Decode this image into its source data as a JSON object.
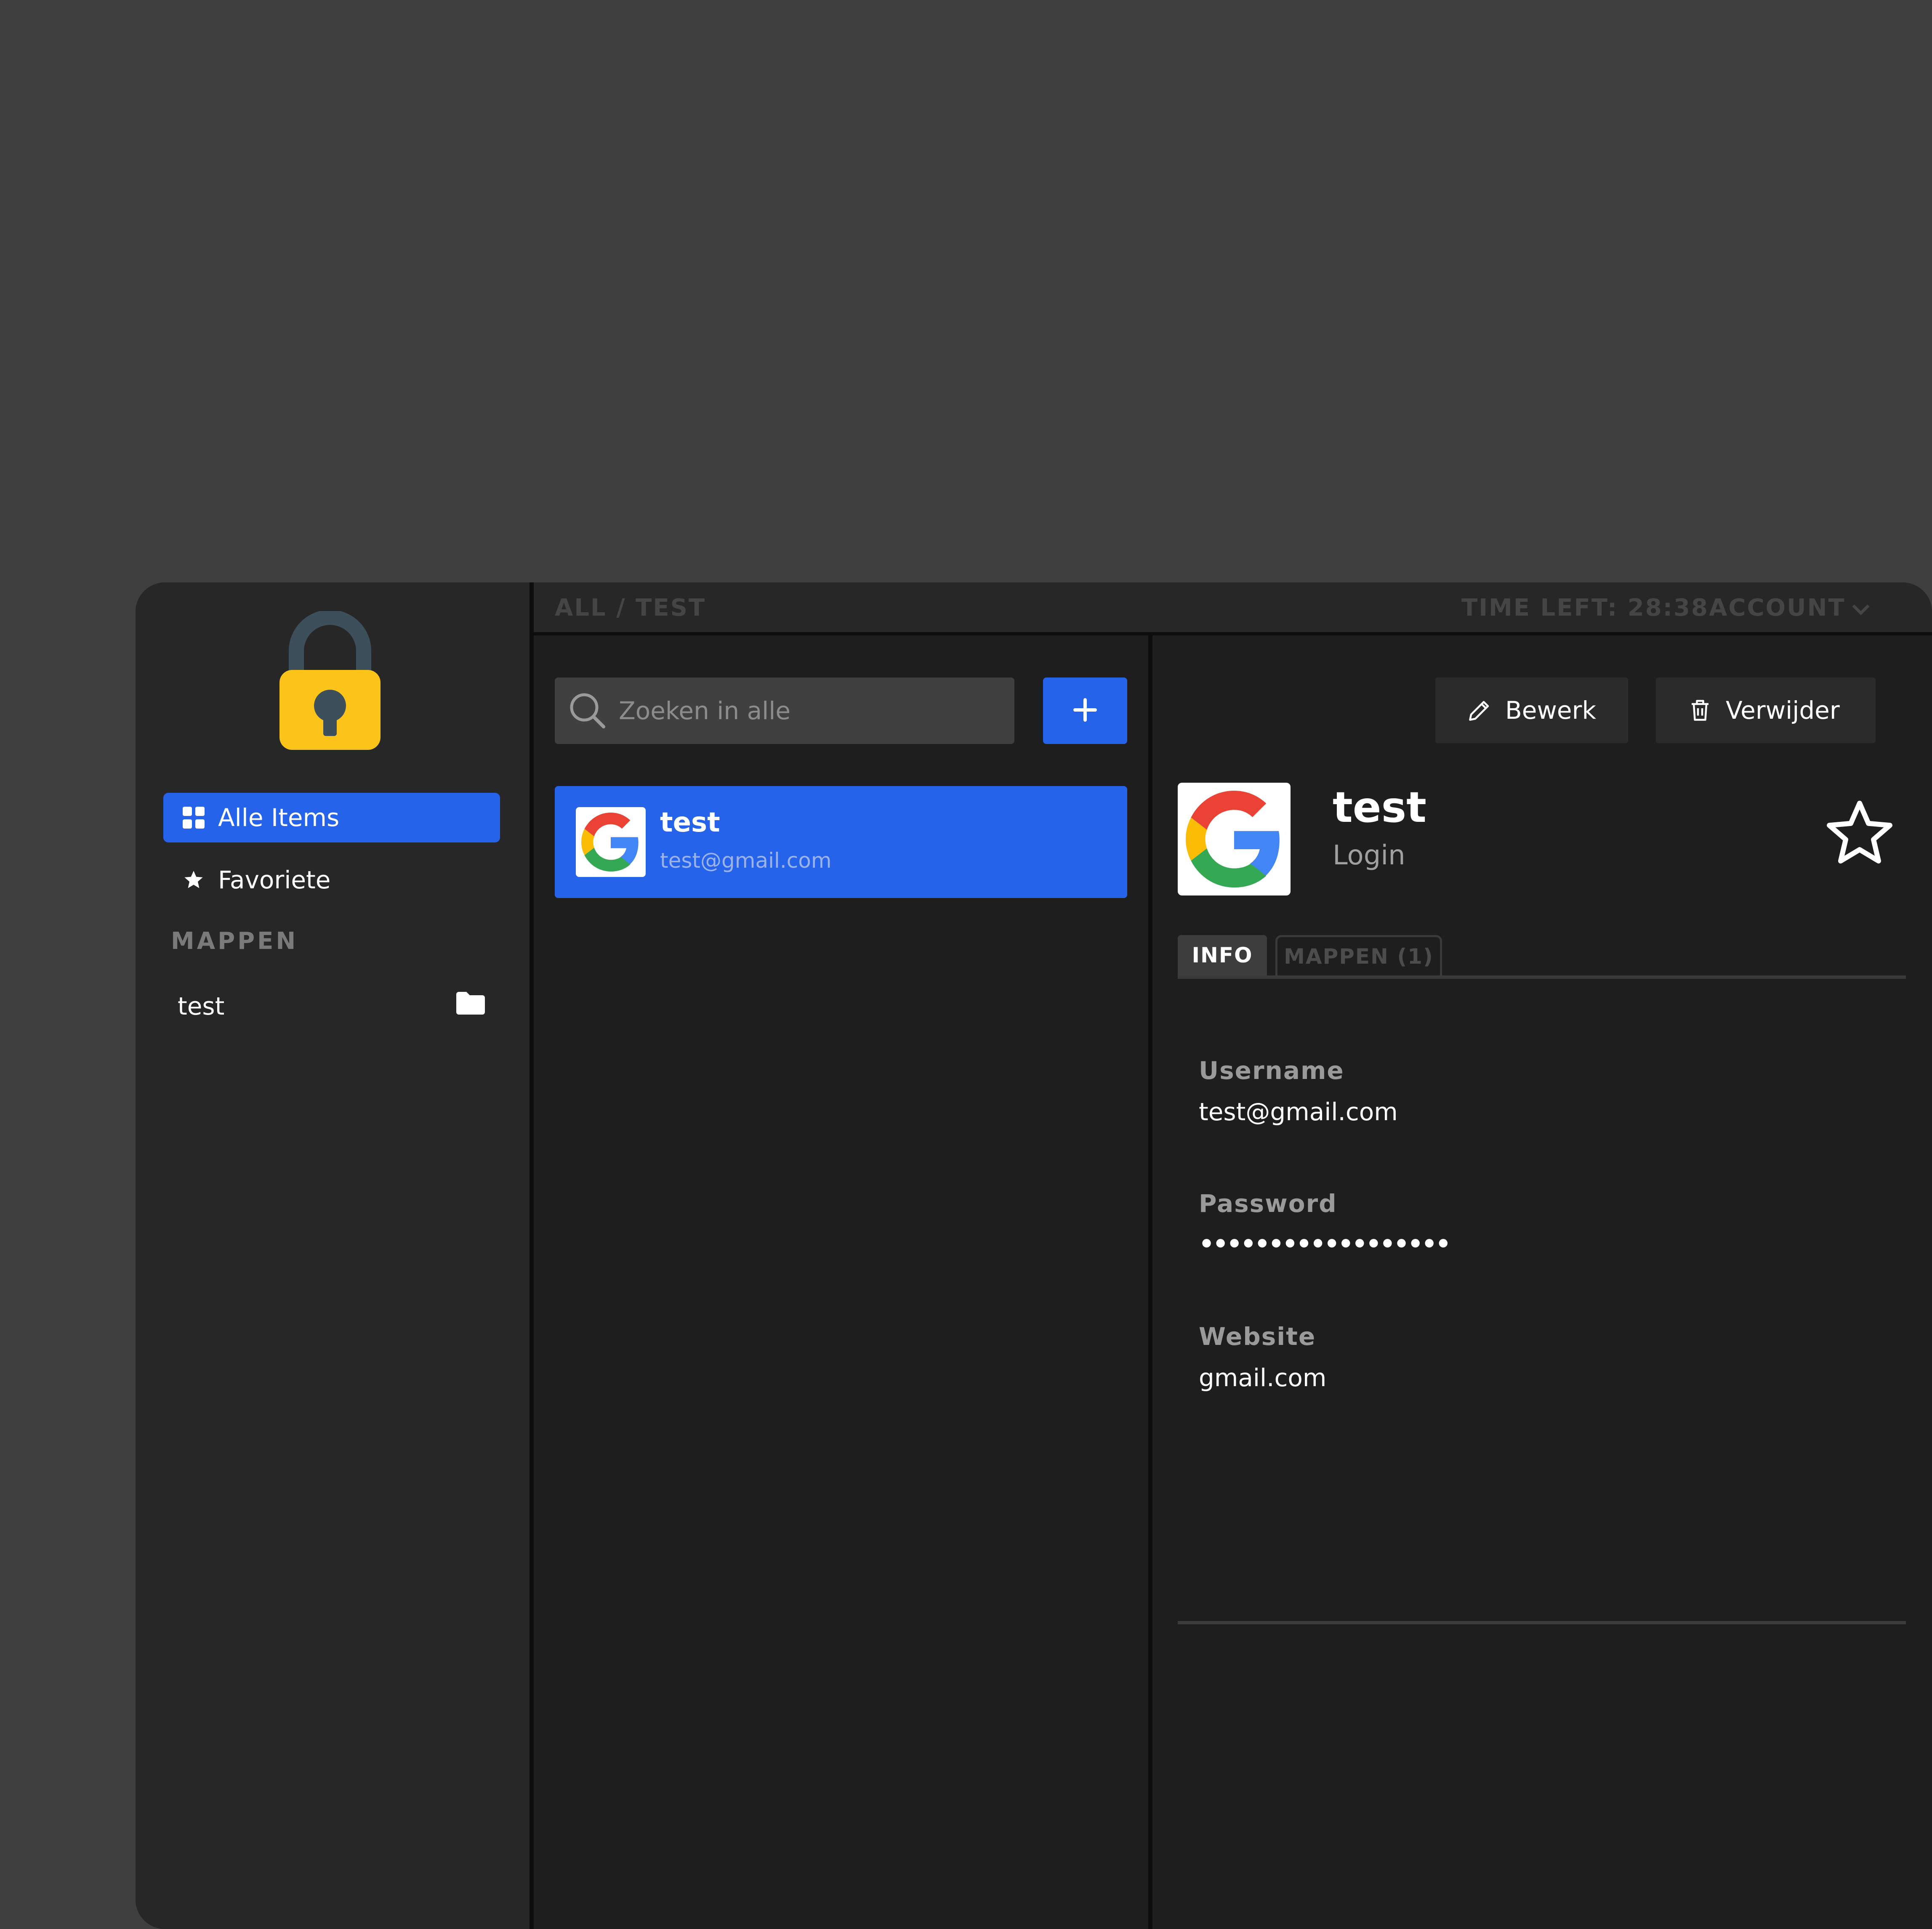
{
  "header": {
    "breadcrumb": "ALL / TEST",
    "time_left": "TIME LEFT: 28:38",
    "account": "ACCOUNT"
  },
  "sidebar": {
    "items": [
      {
        "label": "Alle Items",
        "icon": "grid-icon",
        "active": true
      },
      {
        "label": "Favoriete",
        "icon": "star-icon",
        "active": false
      }
    ],
    "section_label": "MAPPEN",
    "folders": [
      {
        "label": "test",
        "icon": "folder-icon"
      }
    ]
  },
  "list": {
    "search_placeholder": "Zoeken in alle",
    "items": [
      {
        "title": "test",
        "subtitle": "test@gmail.com",
        "icon": "google-icon"
      }
    ]
  },
  "detail": {
    "edit_label": "Bewerk",
    "delete_label": "Verwijder",
    "title": "test",
    "type": "Login",
    "tabs": [
      {
        "label": "INFO",
        "active": true
      },
      {
        "label": "MAPPEN (1)",
        "active": false
      }
    ],
    "fields": [
      {
        "label": "Username",
        "value": "test@gmail.com"
      },
      {
        "label": "Password",
        "value": "••••••••••••••••••"
      },
      {
        "label": "Website",
        "value": "gmail.com"
      }
    ]
  },
  "colors": {
    "accent": "#2563eb",
    "background": "#3f3f3f",
    "panel": "#1e1e1e",
    "sidebar": "#272727",
    "lock_body": "#fcc419",
    "lock_shackle": "#3e4f5c"
  }
}
